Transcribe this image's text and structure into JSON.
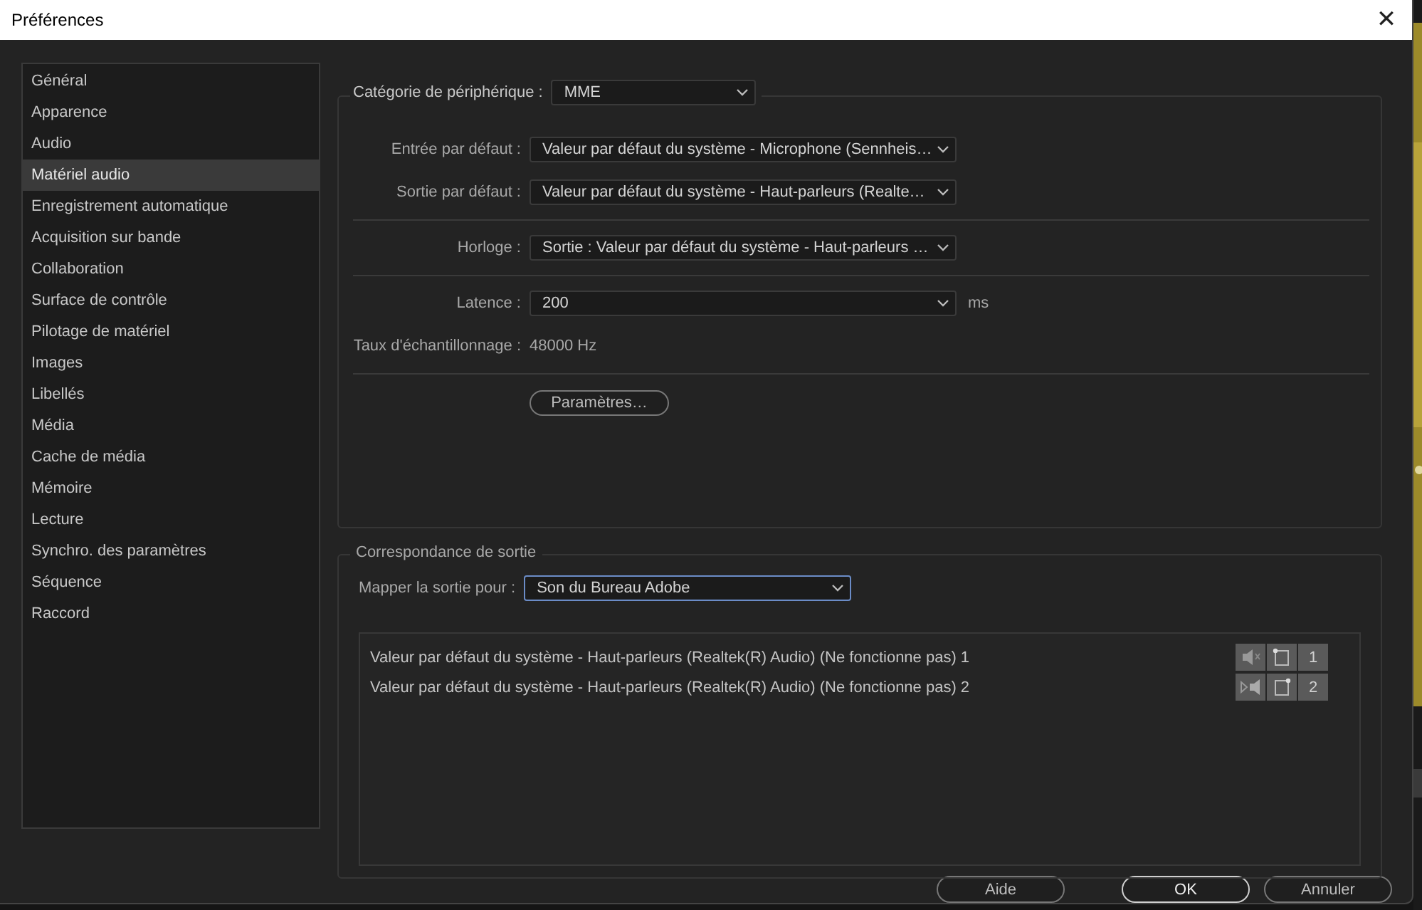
{
  "window": {
    "title": "Préférences",
    "close": "✕"
  },
  "sidebar": {
    "items": [
      {
        "label": "Général",
        "selected": false
      },
      {
        "label": "Apparence",
        "selected": false
      },
      {
        "label": "Audio",
        "selected": false
      },
      {
        "label": "Matériel audio",
        "selected": true
      },
      {
        "label": "Enregistrement automatique",
        "selected": false
      },
      {
        "label": "Acquisition sur bande",
        "selected": false
      },
      {
        "label": "Collaboration",
        "selected": false
      },
      {
        "label": "Surface de contrôle",
        "selected": false
      },
      {
        "label": "Pilotage de matériel",
        "selected": false
      },
      {
        "label": "Images",
        "selected": false
      },
      {
        "label": "Libellés",
        "selected": false
      },
      {
        "label": "Média",
        "selected": false
      },
      {
        "label": "Cache de média",
        "selected": false
      },
      {
        "label": "Mémoire",
        "selected": false
      },
      {
        "label": "Lecture",
        "selected": false
      },
      {
        "label": "Synchro. des paramètres",
        "selected": false
      },
      {
        "label": "Séquence",
        "selected": false
      },
      {
        "label": "Raccord",
        "selected": false
      }
    ]
  },
  "audio_hardware": {
    "category": {
      "label": "Catégorie de périphérique :",
      "value": "MME"
    },
    "default_input": {
      "label": "Entrée par défaut :",
      "value": "Valeur par défaut du système - Microphone (Sennheis…"
    },
    "default_output": {
      "label": "Sortie par défaut :",
      "value": "Valeur par défaut du système - Haut-parleurs (Realte…"
    },
    "clock": {
      "label": "Horloge :",
      "value": "Sortie : Valeur par défaut du système - Haut-parleurs …"
    },
    "latency": {
      "label": "Latence :",
      "value": "200",
      "unit": "ms"
    },
    "sample_rate": {
      "label": "Taux d'échantillonnage :",
      "value": "48000 Hz"
    },
    "settings_button": "Paramètres…"
  },
  "output_mapping": {
    "title": "Correspondance de sortie",
    "map_for": {
      "label": "Mapper la sortie pour :",
      "value": "Son du Bureau Adobe"
    },
    "channels": [
      {
        "name": "Valeur par défaut du système - Haut-parleurs (Realtek(R) Audio) (Ne fonctionne pas) 1",
        "kind": "left",
        "number": "1"
      },
      {
        "name": "Valeur par défaut du système - Haut-parleurs (Realtek(R) Audio) (Ne fonctionne pas) 2",
        "kind": "right",
        "number": "2"
      }
    ]
  },
  "buttons": [
    {
      "label": "Aide",
      "default": false
    },
    {
      "label": "OK",
      "default": true
    },
    {
      "label": "Annuler",
      "default": false
    }
  ]
}
